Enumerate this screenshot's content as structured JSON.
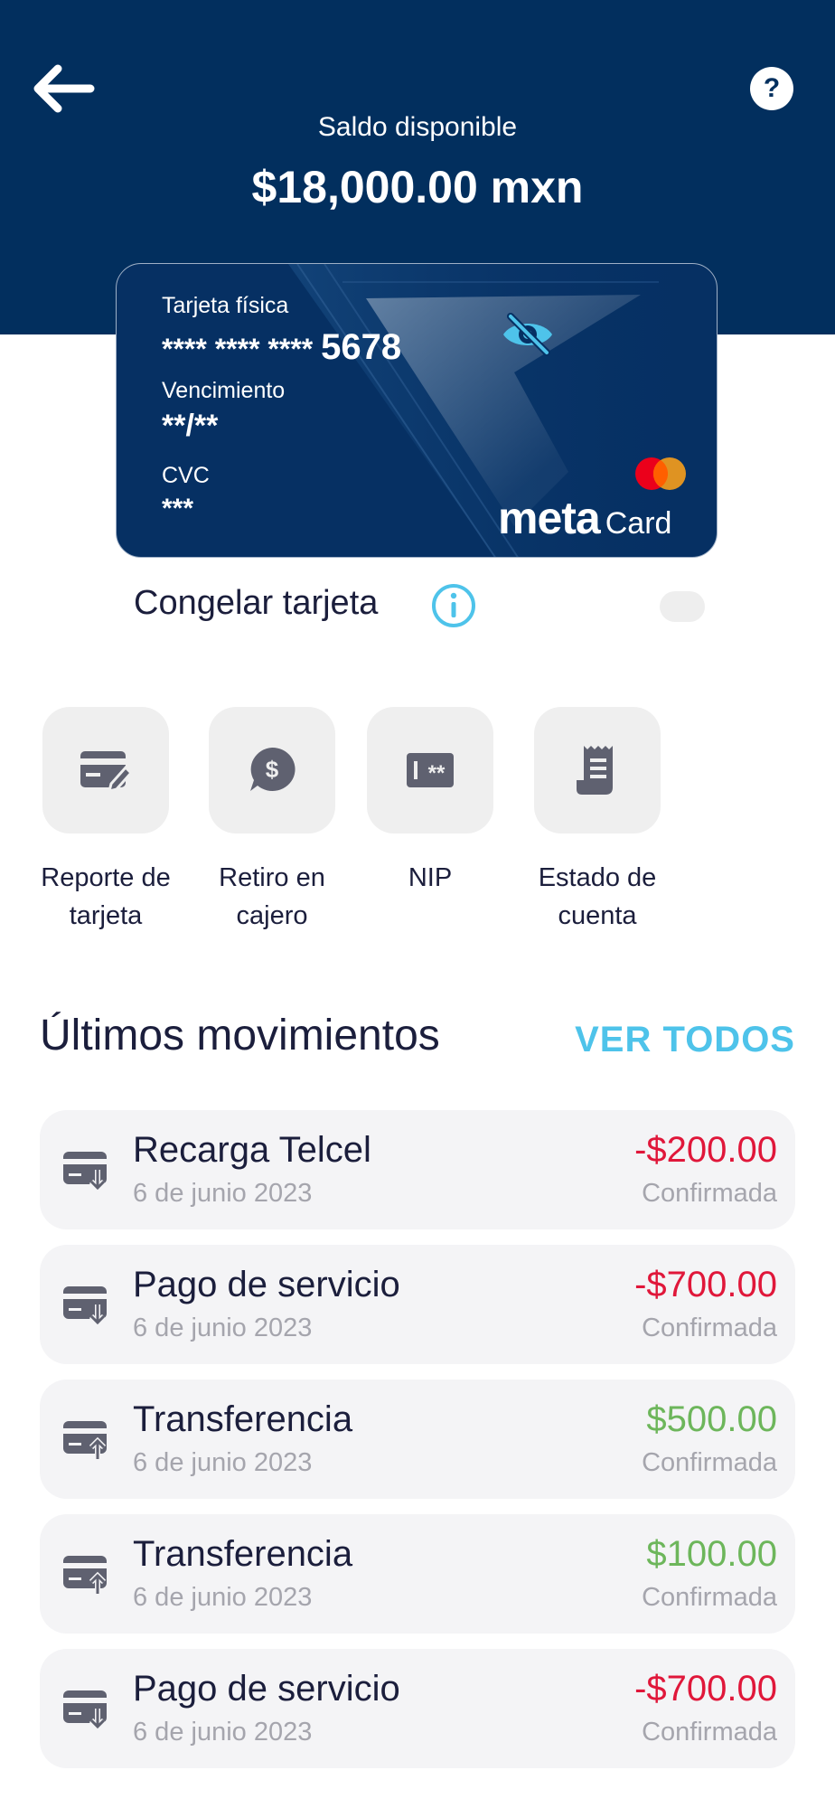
{
  "header": {
    "balance_label": "Saldo disponible",
    "balance_amount": "$18,000.00 mxn",
    "bg_color": "#022f5e"
  },
  "card": {
    "type_label": "Tarjeta física",
    "number_masked": "**** **** ****",
    "number_last4": "5678",
    "expiry_label": "Vencimiento",
    "expiry_value": "**/**",
    "cvc_label": "CVC",
    "cvc_value": "***",
    "brand_text": "meta",
    "brand_suffix": "Card",
    "network": "mastercard"
  },
  "freeze": {
    "label": "Congelar tarjeta",
    "enabled": false
  },
  "actions": [
    {
      "label_line1": "Reporte de",
      "label_line2": "tarjeta",
      "icon": "card-edit-icon"
    },
    {
      "label_line1": "Retiro en",
      "label_line2": "cajero",
      "icon": "cash-bubble-icon"
    },
    {
      "label_line1": "NIP",
      "label_line2": "",
      "icon": "pin-icon"
    },
    {
      "label_line1": "Estado de",
      "label_line2": "cuenta",
      "icon": "receipt-icon"
    }
  ],
  "movements": {
    "title": "Últimos movimientos",
    "see_all": "VER TODOS",
    "items": [
      {
        "name": "Recarga Telcel",
        "date": "6 de junio 2023",
        "amount": "-$200.00",
        "status": "Confirmada",
        "direction": "out"
      },
      {
        "name": "Pago de servicio",
        "date": "6 de junio 2023",
        "amount": "-$700.00",
        "status": "Confirmada",
        "direction": "out"
      },
      {
        "name": "Transferencia",
        "date": "6 de junio 2023",
        "amount": "$500.00",
        "status": "Confirmada",
        "direction": "in"
      },
      {
        "name": "Transferencia",
        "date": "6 de junio 2023",
        "amount": "$100.00",
        "status": "Confirmada",
        "direction": "in"
      },
      {
        "name": "Pago de servicio",
        "date": "6 de junio 2023",
        "amount": "-$700.00",
        "status": "Confirmada",
        "direction": "out"
      }
    ]
  },
  "colors": {
    "accent": "#4ec3ea",
    "negative": "#e0173a",
    "positive": "#6db65b",
    "text": "#1b1e3c",
    "muted": "#a5a5ad"
  }
}
